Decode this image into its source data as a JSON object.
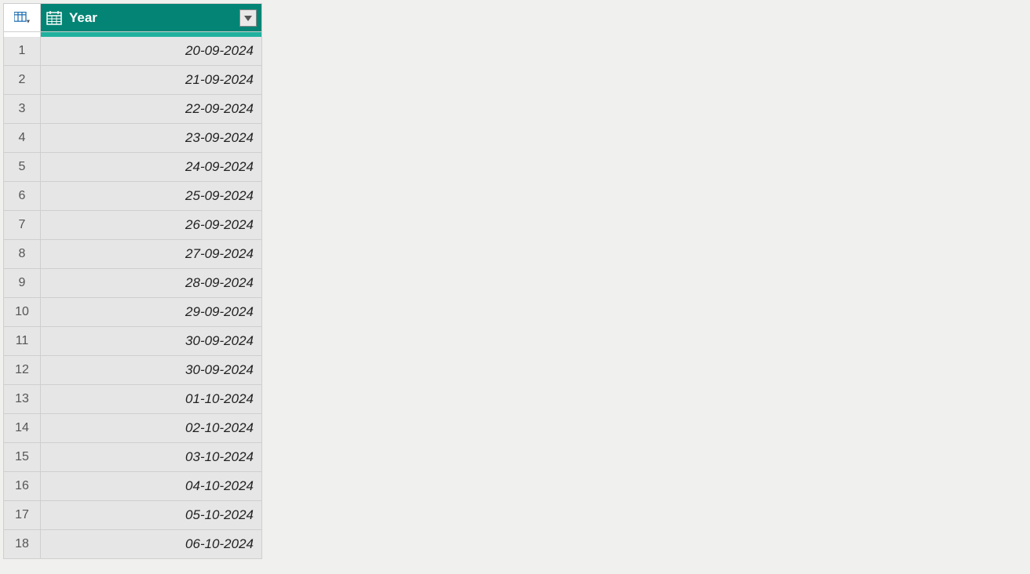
{
  "column": {
    "name": "Year",
    "header_bg": "#048474",
    "accent": "#20b19e"
  },
  "rows": [
    {
      "num": "1",
      "value": "20-09-2024"
    },
    {
      "num": "2",
      "value": "21-09-2024"
    },
    {
      "num": "3",
      "value": "22-09-2024"
    },
    {
      "num": "4",
      "value": "23-09-2024"
    },
    {
      "num": "5",
      "value": "24-09-2024"
    },
    {
      "num": "6",
      "value": "25-09-2024"
    },
    {
      "num": "7",
      "value": "26-09-2024"
    },
    {
      "num": "8",
      "value": "27-09-2024"
    },
    {
      "num": "9",
      "value": "28-09-2024"
    },
    {
      "num": "10",
      "value": "29-09-2024"
    },
    {
      "num": "11",
      "value": "30-09-2024"
    },
    {
      "num": "12",
      "value": "30-09-2024"
    },
    {
      "num": "13",
      "value": "01-10-2024"
    },
    {
      "num": "14",
      "value": "02-10-2024"
    },
    {
      "num": "15",
      "value": "03-10-2024"
    },
    {
      "num": "16",
      "value": "04-10-2024"
    },
    {
      "num": "17",
      "value": "05-10-2024"
    },
    {
      "num": "18",
      "value": "06-10-2024"
    }
  ]
}
